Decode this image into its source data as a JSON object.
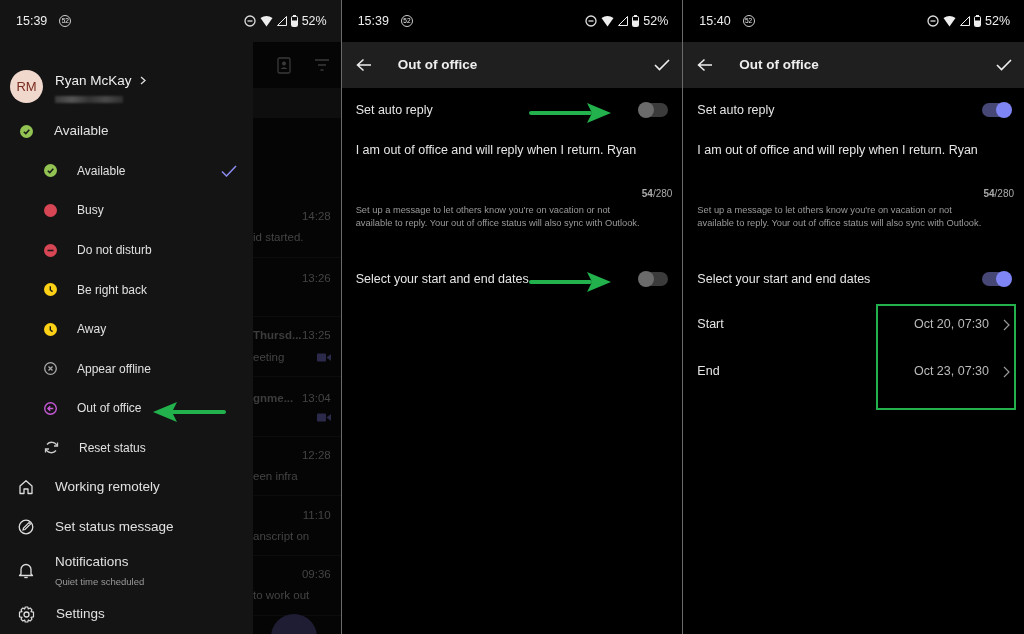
{
  "status_bars": [
    {
      "time": "15:39",
      "notification_count": "52",
      "battery": "52%"
    },
    {
      "time": "15:39",
      "notification_count": "52",
      "battery": "52%"
    },
    {
      "time": "15:40",
      "notification_count": "52",
      "battery": "52%"
    }
  ],
  "drawer": {
    "avatar_initials": "RM",
    "user_name": "Ryan McKay",
    "presence": "Available",
    "statuses": [
      {
        "label": "Available",
        "kind": "available",
        "selected": true,
        "arrow": false
      },
      {
        "label": "Busy",
        "kind": "busy",
        "selected": false,
        "arrow": false
      },
      {
        "label": "Do not disturb",
        "kind": "dnd",
        "selected": false,
        "arrow": false
      },
      {
        "label": "Be right back",
        "kind": "away",
        "selected": false,
        "arrow": false
      },
      {
        "label": "Away",
        "kind": "away",
        "selected": false,
        "arrow": false
      },
      {
        "label": "Appear offline",
        "kind": "offline",
        "selected": false,
        "arrow": false
      },
      {
        "label": "Out of office",
        "kind": "ooo",
        "selected": false,
        "arrow": true
      },
      {
        "label": "Reset status",
        "kind": "reset",
        "selected": false,
        "arrow": false
      }
    ],
    "menu": [
      {
        "label": "Working remotely",
        "kind": "home"
      },
      {
        "label": "Set status message",
        "kind": "edit"
      },
      {
        "label": "Notifications",
        "subtitle": "Quiet time scheduled",
        "kind": "bell"
      },
      {
        "label": "Settings",
        "kind": "gear"
      }
    ]
  },
  "background_chats": [
    {
      "time": "14:28",
      "preview": "id started.",
      "video": false
    },
    {
      "time": "13:26",
      "video": false
    },
    {
      "title": "Thursd...",
      "time": "13:25",
      "preview": "eeting",
      "video": true
    },
    {
      "title": "gnme...",
      "time": "13:04",
      "video": true
    },
    {
      "time": "12:28",
      "preview": "een infra",
      "video": false
    },
    {
      "time": "11:10",
      "preview": "anscript on",
      "video": false
    },
    {
      "time": "09:36",
      "preview": "to work out",
      "video": false
    }
  ],
  "ooo_screens": [
    {
      "title": "Out of office",
      "auto_reply": {
        "label": "Set auto reply",
        "on": false,
        "arrow": true
      },
      "message": "I am out of office and will reply when I return. Ryan",
      "counter": "**54**/280",
      "help": "Set up a message to let others know you're on vacation or not available to reply. Your out of office status will also sync with Outlook.",
      "dates": {
        "label": "Select your start and end dates",
        "on": false,
        "arrow": true
      }
    },
    {
      "title": "Out of office",
      "auto_reply": {
        "label": "Set auto reply",
        "on": true,
        "arrow": false
      },
      "message": "I am out of office and will reply when I return. Ryan",
      "counter": "**54**/280",
      "help": "Set up a message to let others know you're on vacation or not available to reply. Your out of office status will also sync with Outlook.",
      "dates": {
        "label": "Select your start and end dates",
        "on": true,
        "arrow": false
      },
      "highlight": true,
      "date_rows": [
        {
          "label": "Start",
          "value": "Oct 20, 07:30"
        },
        {
          "label": "End",
          "value": "Oct 23, 07:30"
        }
      ]
    }
  ]
}
